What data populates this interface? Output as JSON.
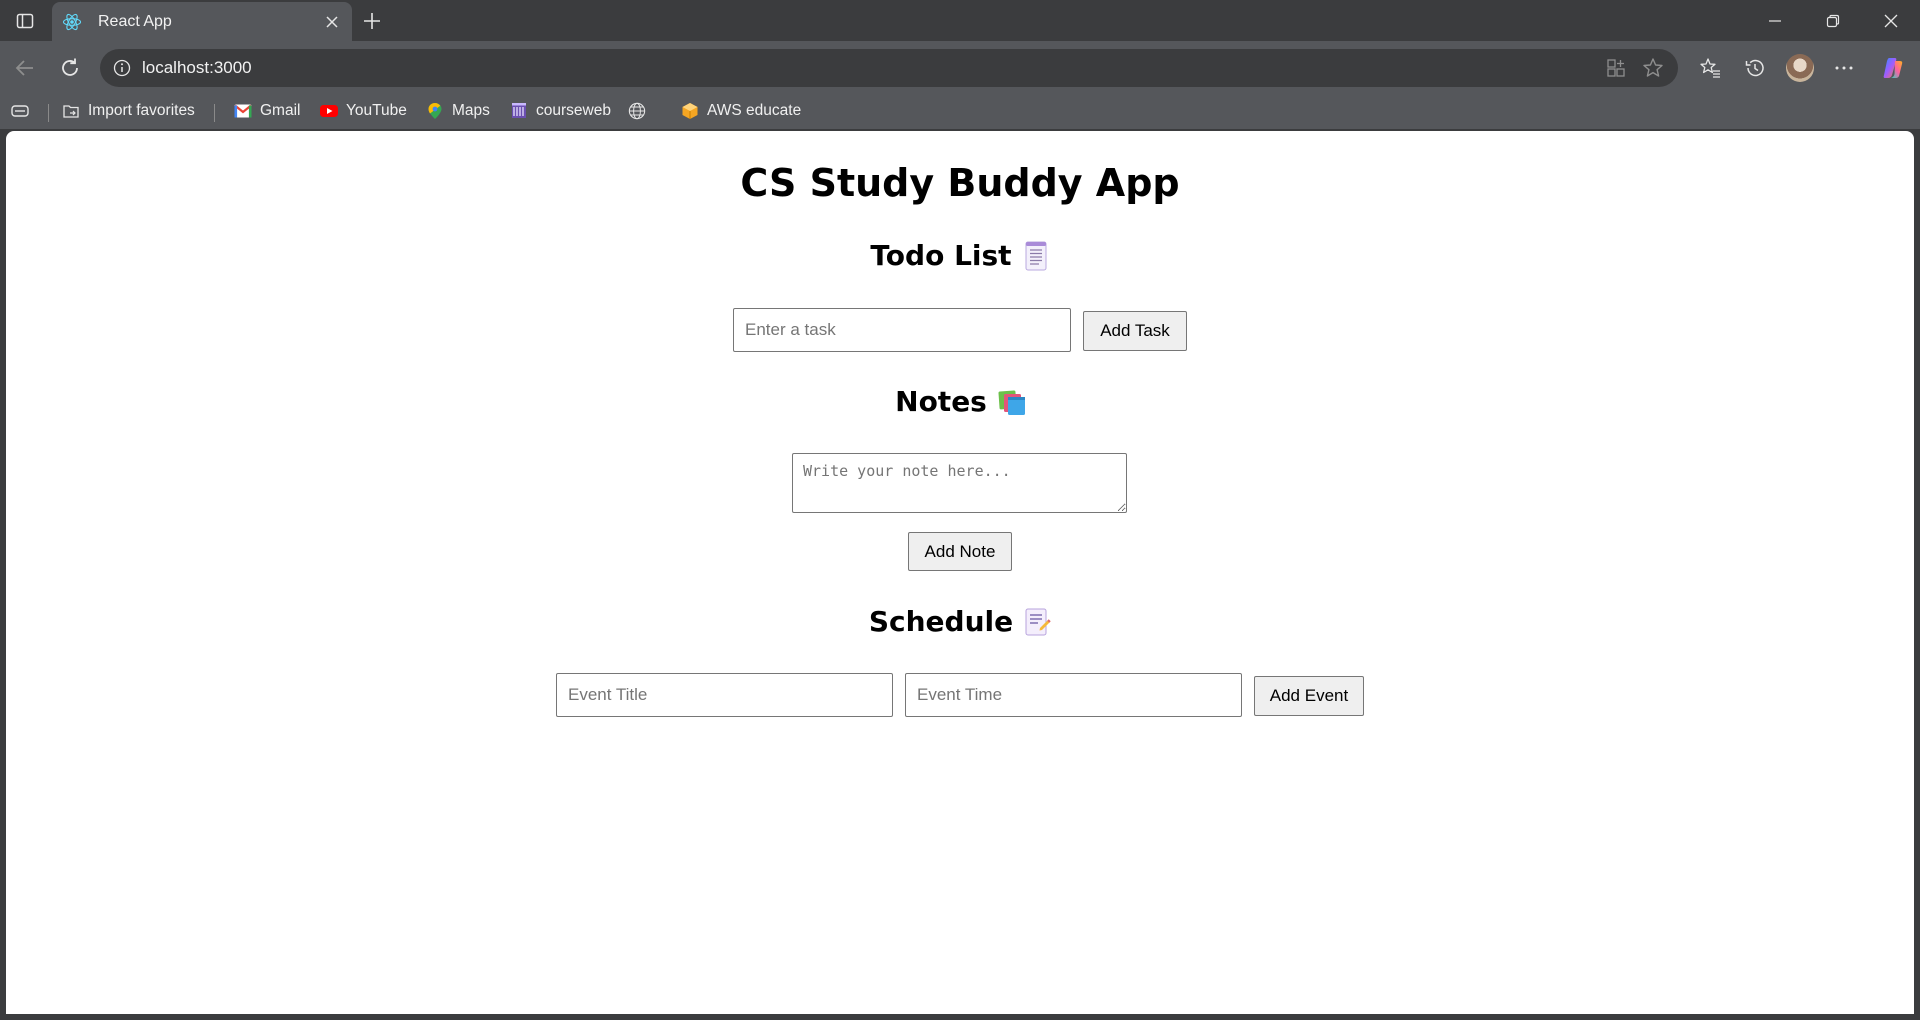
{
  "browser": {
    "tab": {
      "title": "React App",
      "favicon": "react-logo-icon"
    },
    "address_bar": {
      "url": "localhost:3000"
    },
    "bookmarks": [
      {
        "label": "Import favorites",
        "icon": "import-favorites-icon"
      },
      {
        "label": "Gmail",
        "icon": "gmail-icon"
      },
      {
        "label": "YouTube",
        "icon": "youtube-icon"
      },
      {
        "label": "Maps",
        "icon": "maps-icon"
      },
      {
        "label": "courseweb",
        "icon": "courseweb-icon"
      },
      {
        "label": "",
        "icon": "globe-icon"
      },
      {
        "label": "AWS educate",
        "icon": "aws-educate-icon"
      }
    ]
  },
  "app": {
    "title": "CS Study Buddy App",
    "todo": {
      "heading": "Todo List",
      "icon": "memo-icon",
      "input_placeholder": "Enter a task",
      "input_value": "",
      "button_label": "Add Task"
    },
    "notes": {
      "heading": "Notes",
      "icon": "books-icon",
      "textarea_placeholder": "Write your note here...",
      "textarea_value": "",
      "button_label": "Add Note"
    },
    "schedule": {
      "heading": "Schedule",
      "icon": "notepad-icon",
      "title_placeholder": "Event Title",
      "time_placeholder": "Event Time",
      "button_label": "Add Event"
    }
  },
  "colors": {
    "chrome_dark": "#3b3c3e",
    "chrome_toolbar": "#55575b",
    "page_background": "#ffffff",
    "button_background": "#efefef"
  }
}
